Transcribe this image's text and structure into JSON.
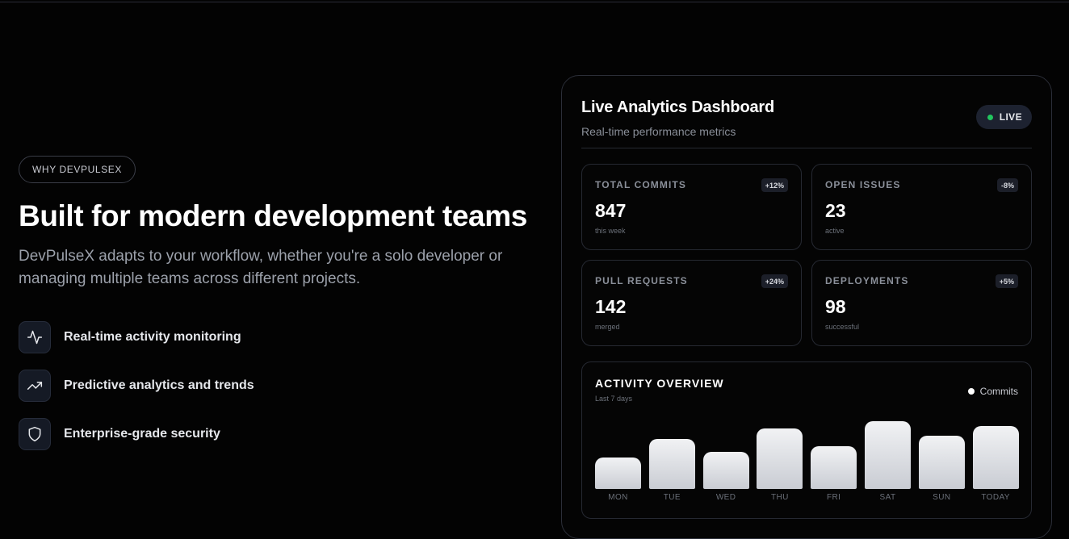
{
  "section": {
    "badge": "WHY DEVPULSEX",
    "headline": "Built for modern development teams",
    "lead": "DevPulseX adapts to your workflow, whether you're a solo developer or managing multiple teams across different projects.",
    "features": [
      {
        "icon": "activity-icon",
        "label": "Real-time activity monitoring"
      },
      {
        "icon": "trending-up-icon",
        "label": "Predictive analytics and trends"
      },
      {
        "icon": "shield-icon",
        "label": "Enterprise-grade security"
      }
    ]
  },
  "dashboard": {
    "title": "Live Analytics Dashboard",
    "subtitle": "Real-time performance metrics",
    "live_label": "LIVE",
    "live_color": "#22c55e",
    "stats": [
      {
        "label": "TOTAL COMMITS",
        "change": "+12%",
        "value": "847",
        "note": "this week"
      },
      {
        "label": "OPEN ISSUES",
        "change": "-8%",
        "value": "23",
        "note": "active"
      },
      {
        "label": "PULL REQUESTS",
        "change": "+24%",
        "value": "142",
        "note": "merged"
      },
      {
        "label": "DEPLOYMENTS",
        "change": "+5%",
        "value": "98",
        "note": "successful"
      }
    ],
    "activity": {
      "title": "ACTIVITY OVERVIEW",
      "subtitle": "Last 7 days",
      "legend": "Commits"
    }
  },
  "chart_data": {
    "type": "bar",
    "categories": [
      "MON",
      "TUE",
      "WED",
      "THU",
      "FRI",
      "SAT",
      "SUN",
      "TODAY"
    ],
    "series": [
      {
        "name": "Commits",
        "values": [
          45,
          71,
          53,
          86,
          61,
          97,
          76,
          90
        ]
      }
    ],
    "ylim": [
      0,
      100
    ],
    "legend": "top-right",
    "grid": false
  }
}
